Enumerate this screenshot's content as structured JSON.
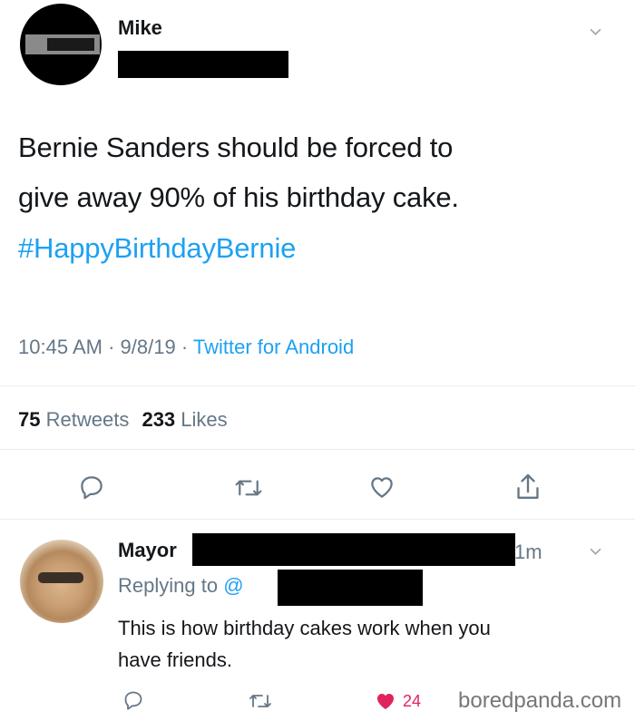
{
  "tweet": {
    "name": "Mike",
    "text_line1": "Bernie Sanders should be forced to",
    "text_line2": "give away 90% of his birthday cake.",
    "hashtag": "#HappyBirthdayBernie",
    "time": "10:45 AM",
    "date": "9/8/19",
    "source": "Twitter for Android",
    "retweets_count": "75",
    "retweets_label": "Retweets",
    "likes_count": "233",
    "likes_label": "Likes"
  },
  "reply": {
    "name": "Mayor",
    "time": "1m",
    "replying_prefix": "Replying to",
    "replying_handle": "@",
    "text_line1": "This is how birthday cakes work when you",
    "text_line2": "have friends.",
    "like_count": "24"
  },
  "watermark": "boredpanda.com",
  "colors": {
    "accent": "#1da1f2",
    "muted": "#657786",
    "like_red": "#e0245e",
    "redaction": "#000000"
  },
  "icons": [
    "reply-icon",
    "retweet-icon",
    "like-icon",
    "share-icon",
    "chevron-down-icon"
  ]
}
